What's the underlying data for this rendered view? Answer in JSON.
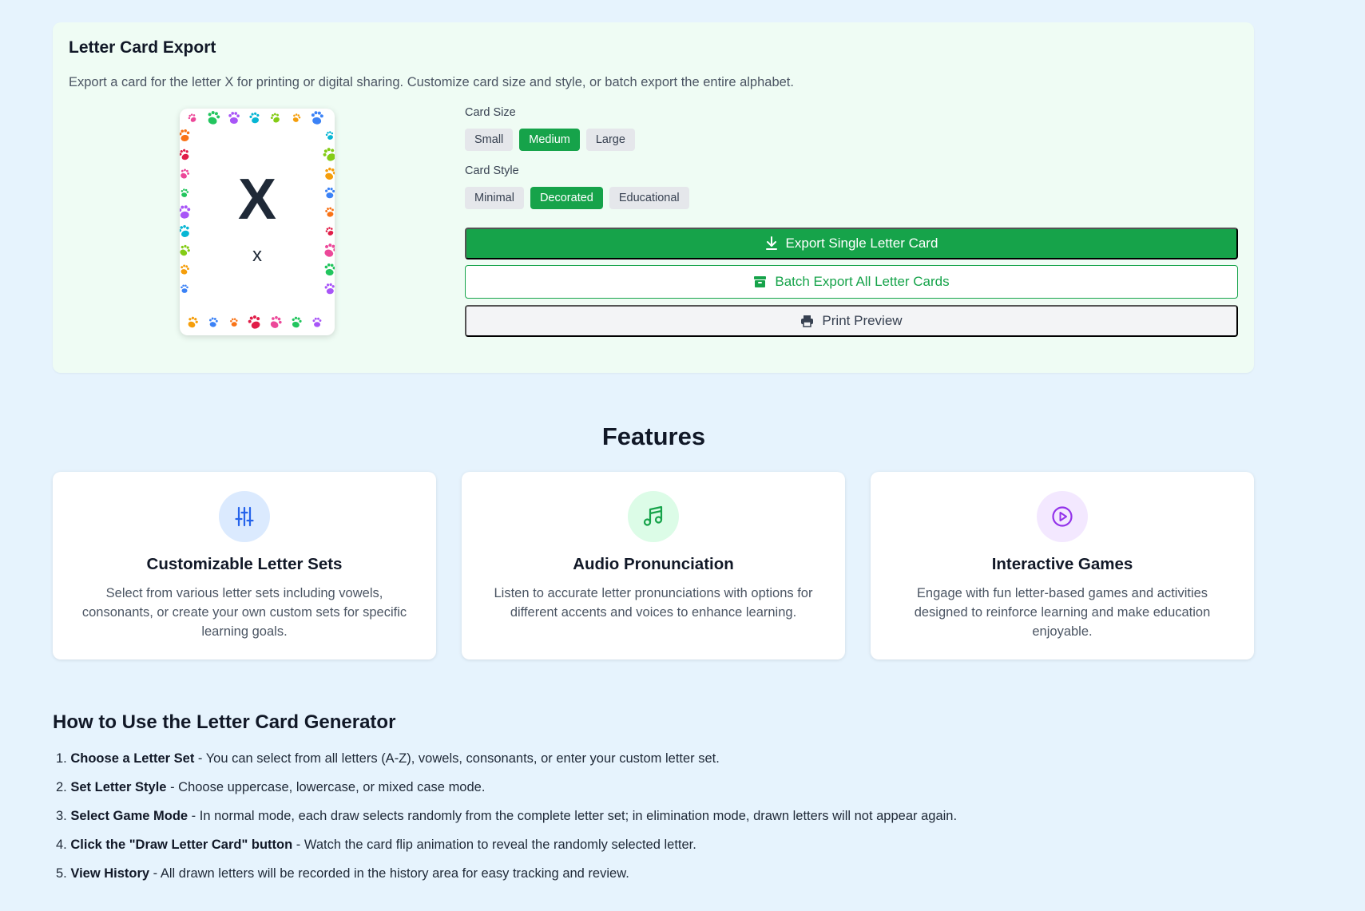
{
  "export": {
    "title": "Letter Card Export",
    "description": "Export a card for the letter X for printing or digital sharing. Customize card size and style, or batch export the entire alphabet.",
    "card": {
      "upper": "X",
      "lower": "x"
    },
    "size_label": "Card Size",
    "sizes": [
      "Small",
      "Medium",
      "Large"
    ],
    "style_label": "Card Style",
    "styles": [
      "Minimal",
      "Decorated",
      "Educational"
    ],
    "export_single": "Export Single Letter Card",
    "batch_export": "Batch Export All Letter Cards",
    "print_preview": "Print Preview",
    "colors": {
      "accent": "#16a34a",
      "panel_bg": "#effcf4"
    }
  },
  "features": {
    "title": "Features",
    "items": [
      {
        "icon": "sliders-icon",
        "title": "Customizable Letter Sets",
        "desc": "Select from various letter sets including vowels, consonants, or create your own custom sets for specific learning goals.",
        "color": "#2563eb",
        "bg": "#dbeafe"
      },
      {
        "icon": "music-note-icon",
        "title": "Audio Pronunciation",
        "desc": "Listen to accurate letter pronunciations with options for different accents and voices to enhance learning.",
        "color": "#16a34a",
        "bg": "#dcfce7"
      },
      {
        "icon": "play-circle-icon",
        "title": "Interactive Games",
        "desc": "Engage with fun letter-based games and activities designed to reinforce learning and make education enjoyable.",
        "color": "#9333ea",
        "bg": "#f3e8ff"
      }
    ]
  },
  "howto": {
    "title": "How to Use the Letter Card Generator",
    "steps": [
      {
        "num": "1.",
        "bold": "Choose a Letter Set",
        "text": " - You can select from all letters (A-Z), vowels, consonants, or enter your custom letter set."
      },
      {
        "num": "2.",
        "bold": "Set Letter Style",
        "text": " - Choose uppercase, lowercase, or mixed case mode."
      },
      {
        "num": "3.",
        "bold": "Select Game Mode",
        "text": " - In normal mode, each draw selects randomly from the complete letter set; in elimination mode, drawn letters will not appear again."
      },
      {
        "num": "4.",
        "bold": "Click the \"Draw Letter Card\" button",
        "text": " - Watch the card flip animation to reveal the randomly selected letter."
      },
      {
        "num": "5.",
        "bold": "View History",
        "text": " - All drawn letters will be recorded in the history area for easy tracking and review."
      }
    ]
  }
}
